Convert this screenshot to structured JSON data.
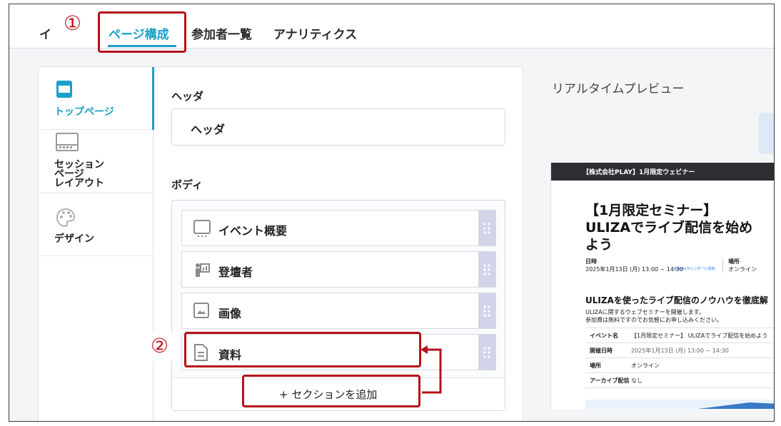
{
  "tabs": [
    {
      "label": "イ"
    },
    {
      "label": "ページ構成"
    },
    {
      "label": "参加者一覧"
    },
    {
      "label": "アナリティクス"
    }
  ],
  "callouts": {
    "one": "①",
    "two": "②"
  },
  "side_nav": [
    {
      "label_lines": [
        "トップページ"
      ],
      "icon": "page-icon"
    },
    {
      "label_lines": [
        "セッション",
        "ページ",
        "レイアウト"
      ],
      "icon": "layout-icon"
    },
    {
      "label_lines": [
        "デザイン"
      ],
      "icon": "palette-icon"
    }
  ],
  "editor": {
    "header_heading": "ヘッダ",
    "header_field": "ヘッダ",
    "body_heading": "ボディ",
    "body_rows": [
      {
        "label": "イベント概要",
        "icon": "event-overview-icon"
      },
      {
        "label": "登壇者",
        "icon": "speaker-icon"
      },
      {
        "label": "画像",
        "icon": "image-icon"
      },
      {
        "label": "資料",
        "icon": "document-icon"
      }
    ],
    "add_section_label": "+ セクションを追加"
  },
  "preview": {
    "title": "リアルタイムプレビュー",
    "top_bar": "【株式会社PLAY】1月限定ウェビナー",
    "heading_lines": [
      "【1月限定セミナー】",
      "ULIZAでライブ配信を始め",
      "よう"
    ],
    "date_label": "日時",
    "date_value": "2025年1月13日 (月) 13:00 ~ 14:30",
    "calendar_link": "Googleカレンダーに追加",
    "place_label": "場所",
    "place_value": "オンライン",
    "sub_heading": "ULIZAを使ったライブ配信のノウハウを徹底解",
    "desc_lines": [
      "ULIZAに関するウェブセミナーを開催します。",
      "参加費は無料ですのでお気軽にお申し込みください。"
    ],
    "table": [
      {
        "key": "イベント名",
        "value": "【1月限定セミナー】 ULIZAでライブ配信を始めよう"
      },
      {
        "key": "開催日時",
        "value": "2025年1月13日 (月) 13:00 ~ 14:30"
      },
      {
        "key": "場所",
        "value": "オンライン"
      },
      {
        "key": "アーカイブ配信",
        "value": "なし"
      }
    ]
  },
  "colors": {
    "accent": "#1aa0c9",
    "annotation_red": "#b3121a",
    "handle": "#d2d4ea"
  }
}
